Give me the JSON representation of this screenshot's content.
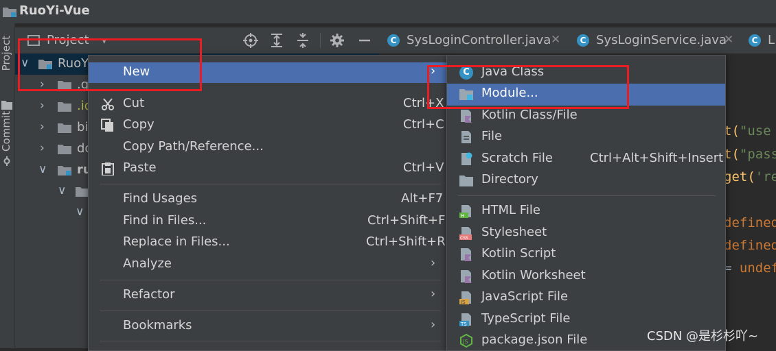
{
  "window": {
    "title": "RuoYi-Vue"
  },
  "side_tabs": {
    "project": "Project",
    "commit": "Commit"
  },
  "project_panel": {
    "title": "Project"
  },
  "tree": [
    {
      "label": "RuoY",
      "color": "#bbbbbb"
    },
    {
      "label": ".g",
      "color": "#bbbbbb"
    },
    {
      "label": ".id",
      "color": "#b7b749"
    },
    {
      "label": "bi",
      "color": "#bbbbbb"
    },
    {
      "label": "do",
      "color": "#bbbbbb"
    },
    {
      "label": "ru",
      "color": "#bbbbbb"
    }
  ],
  "editor_tabs": [
    {
      "icon": "C",
      "label": "SysLoginController.java"
    },
    {
      "icon": "C",
      "label": "SysLoginService.java"
    },
    {
      "icon": "C",
      "label": "L"
    }
  ],
  "code_lines": [
    {
      "a": "t(",
      "b": "\"use"
    },
    {
      "a": "t(",
      "b": "\"pass"
    },
    {
      "a": "get(",
      "b": "'re"
    },
    {
      "a": "",
      "b": ""
    },
    {
      "a": "defined",
      "b": ""
    },
    {
      "a": "defined",
      "b": ""
    },
    {
      "a": "= ",
      "b": "undef"
    }
  ],
  "context_menu": {
    "items": [
      {
        "label": "New",
        "shortcut": "",
        "submenu": true
      },
      {
        "label": "Cut",
        "shortcut": "Ctrl+X",
        "submenu": false
      },
      {
        "label": "Copy",
        "shortcut": "Ctrl+C",
        "submenu": false
      },
      {
        "label": "Copy Path/Reference...",
        "shortcut": "",
        "submenu": false
      },
      {
        "label": "Paste",
        "shortcut": "Ctrl+V",
        "submenu": false
      },
      {
        "label": "Find Usages",
        "shortcut": "Alt+F7",
        "submenu": false
      },
      {
        "label": "Find in Files...",
        "shortcut": "Ctrl+Shift+F",
        "submenu": false
      },
      {
        "label": "Replace in Files...",
        "shortcut": "Ctrl+Shift+R",
        "submenu": false
      },
      {
        "label": "Analyze",
        "shortcut": "",
        "submenu": true
      },
      {
        "label": "Refactor",
        "shortcut": "",
        "submenu": true
      },
      {
        "label": "Bookmarks",
        "shortcut": "",
        "submenu": true
      }
    ]
  },
  "new_submenu": {
    "items": [
      {
        "label": "Java Class",
        "shortcut": "",
        "icon": "java-class-icon"
      },
      {
        "label": "Module...",
        "shortcut": "",
        "icon": "module-icon"
      },
      {
        "label": "Kotlin Class/File",
        "shortcut": "",
        "icon": "kotlin-file-icon"
      },
      {
        "label": "File",
        "shortcut": "",
        "icon": "file-icon"
      },
      {
        "label": "Scratch File",
        "shortcut": "Ctrl+Alt+Shift+Insert",
        "icon": "scratch-file-icon"
      },
      {
        "label": "Directory",
        "shortcut": "",
        "icon": "directory-icon"
      },
      {
        "label": "HTML File",
        "shortcut": "",
        "icon": "html-file-icon"
      },
      {
        "label": "Stylesheet",
        "shortcut": "",
        "icon": "stylesheet-icon"
      },
      {
        "label": "Kotlin Script",
        "shortcut": "",
        "icon": "kotlin-script-icon"
      },
      {
        "label": "Kotlin Worksheet",
        "shortcut": "",
        "icon": "kotlin-worksheet-icon"
      },
      {
        "label": "JavaScript File",
        "shortcut": "",
        "icon": "javascript-file-icon"
      },
      {
        "label": "TypeScript File",
        "shortcut": "",
        "icon": "typescript-file-icon"
      },
      {
        "label": "package.json File",
        "shortcut": "",
        "icon": "package-json-icon"
      }
    ]
  },
  "watermark": "CSDN @是杉杉吖~",
  "colors": {
    "menu_bg": "#3c3f41",
    "highlight": "#4b6eaf",
    "annotation_red": "#ea1c24",
    "tree_selection": "#0d293e"
  }
}
